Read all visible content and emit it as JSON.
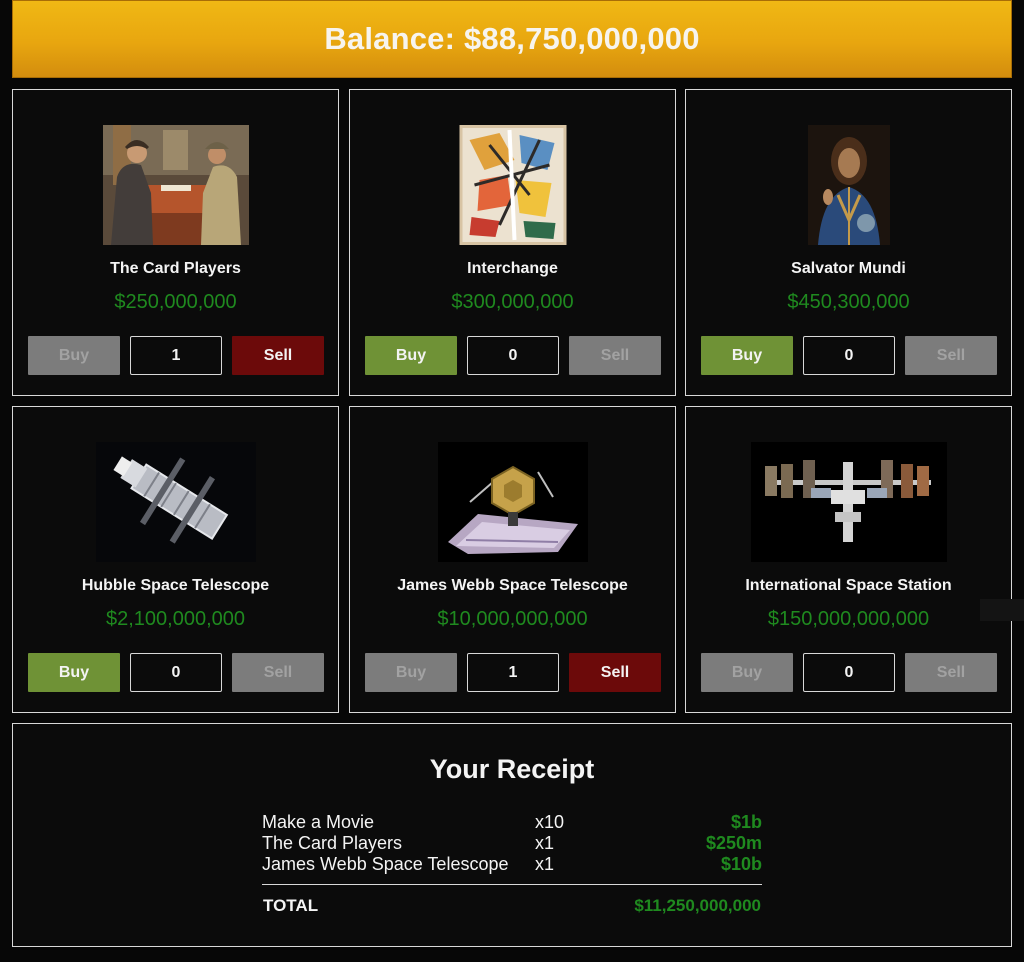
{
  "balance": {
    "text": "Balance: $88,750,000,000"
  },
  "products": [
    {
      "name": "The Card Players",
      "price": "$250,000,000",
      "buy_label": "Buy",
      "sell_label": "Sell",
      "quantity": "1",
      "image": "painting-card-players"
    },
    {
      "name": "Interchange",
      "price": "$300,000,000",
      "buy_label": "Buy",
      "sell_label": "Sell",
      "quantity": "0",
      "image": "painting-interchange"
    },
    {
      "name": "Salvator Mundi",
      "price": "$450,300,000",
      "buy_label": "Buy",
      "sell_label": "Sell",
      "quantity": "0",
      "image": "painting-salvator-mundi"
    },
    {
      "name": "Hubble Space Telescope",
      "price": "$2,100,000,000",
      "buy_label": "Buy",
      "sell_label": "Sell",
      "quantity": "0",
      "image": "hubble-telescope-photo"
    },
    {
      "name": "James Webb Space Telescope",
      "price": "$10,000,000,000",
      "buy_label": "Buy",
      "sell_label": "Sell",
      "quantity": "1",
      "image": "jwst-photo"
    },
    {
      "name": "International Space Station",
      "price": "$150,000,000,000",
      "buy_label": "Buy",
      "sell_label": "Sell",
      "quantity": "0",
      "image": "iss-photo"
    }
  ],
  "receipt": {
    "title": "Your Receipt",
    "items": [
      {
        "name": "Make a Movie",
        "qty": "x10",
        "amount": "$1b"
      },
      {
        "name": "The Card Players",
        "qty": "x1",
        "amount": "$250m"
      },
      {
        "name": "James Webb Space Telescope",
        "qty": "x1",
        "amount": "$10b"
      }
    ],
    "total_label": "TOTAL",
    "total_amount": "$11,250,000,000"
  },
  "colors": {
    "balance_bar": "#e8a60f",
    "price_green": "#1f8a1f",
    "buy_enabled": "#6f9236",
    "sell_enabled": "#6c0a0a",
    "disabled": "#7c7c7c"
  }
}
